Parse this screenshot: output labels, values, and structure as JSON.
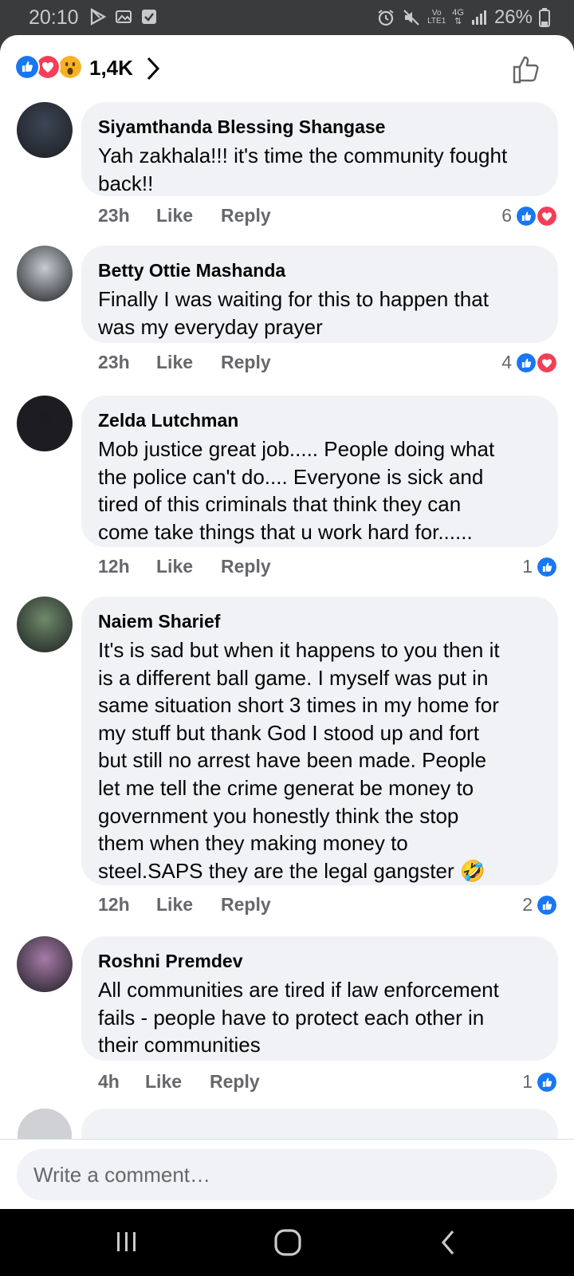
{
  "status_bar": {
    "time": "20:10",
    "left_icons": [
      "play-store-icon",
      "image-notification-icon",
      "checkbox-notification-icon"
    ],
    "right_icons": [
      "alarm-icon",
      "mute-icon",
      "volte-icon",
      "4g-icon",
      "signal-icon",
      "battery-icon"
    ],
    "network_top": "Vo",
    "network_bottom": "LTE1",
    "network_gen": "4G",
    "battery_percent": "26%"
  },
  "reactions_header": {
    "icons": [
      "like-reaction-icon",
      "love-reaction-icon",
      "wow-reaction-icon"
    ],
    "count": "1,4K"
  },
  "comments": [
    {
      "author": "Siyamthanda Blessing Shangase",
      "lines": [
        "Yah zakhala!!! it's time the community fought",
        "back!!"
      ],
      "time": "23h",
      "like_label": "Like",
      "reply_label": "Reply",
      "reaction_count": "6",
      "reactions": [
        "like",
        "love"
      ]
    },
    {
      "author": "Betty Ottie Mashanda",
      "lines": [
        "Finally I was waiting for this to happen that",
        "was my everyday prayer"
      ],
      "time": "23h",
      "like_label": "Like",
      "reply_label": "Reply",
      "reaction_count": "4",
      "reactions": [
        "like",
        "love"
      ]
    },
    {
      "author": "Zelda Lutchman",
      "lines": [
        "Mob justice great job..... People doing what",
        "the police can't do.... Everyone is sick and",
        "tired of this criminals that think they can",
        "come take things that u work hard for......"
      ],
      "time": "12h",
      "like_label": "Like",
      "reply_label": "Reply",
      "reaction_count": "1",
      "reactions": [
        "like"
      ]
    },
    {
      "author": "Naiem Sharief",
      "lines": [
        "It's is sad but when it happens to you then it",
        "is a different ball game. I myself was put in",
        "same situation short 3 times in my home for",
        "my stuff but thank God I stood up and fort",
        "but still no arrest have been made. People",
        "let me tell the crime generat be money to",
        "government you honestly think the stop",
        "them when they making money to",
        "steel.SAPS they are the legal gangster 🤣"
      ],
      "time": "12h",
      "like_label": "Like",
      "reply_label": "Reply",
      "reaction_count": "2",
      "reactions": [
        "like"
      ]
    },
    {
      "author": "Roshni Premdev",
      "lines": [
        "All communities are tired if law enforcement",
        "fails - people have to protect each other in",
        "their communities"
      ],
      "time": "4h",
      "like_label": "Like",
      "reply_label": "Reply",
      "reaction_count": "1",
      "reactions": [
        "like"
      ]
    }
  ],
  "composer": {
    "placeholder": "Write a comment…"
  },
  "nav_bar": {
    "buttons": [
      "recents-icon",
      "home-icon",
      "back-icon"
    ]
  },
  "colors": {
    "like_blue": "#1877f2",
    "love_red": "#f33e58",
    "wow_yellow": "#f7b125",
    "bubble_gray": "#f0f2f5",
    "meta_gray": "#65676b"
  }
}
